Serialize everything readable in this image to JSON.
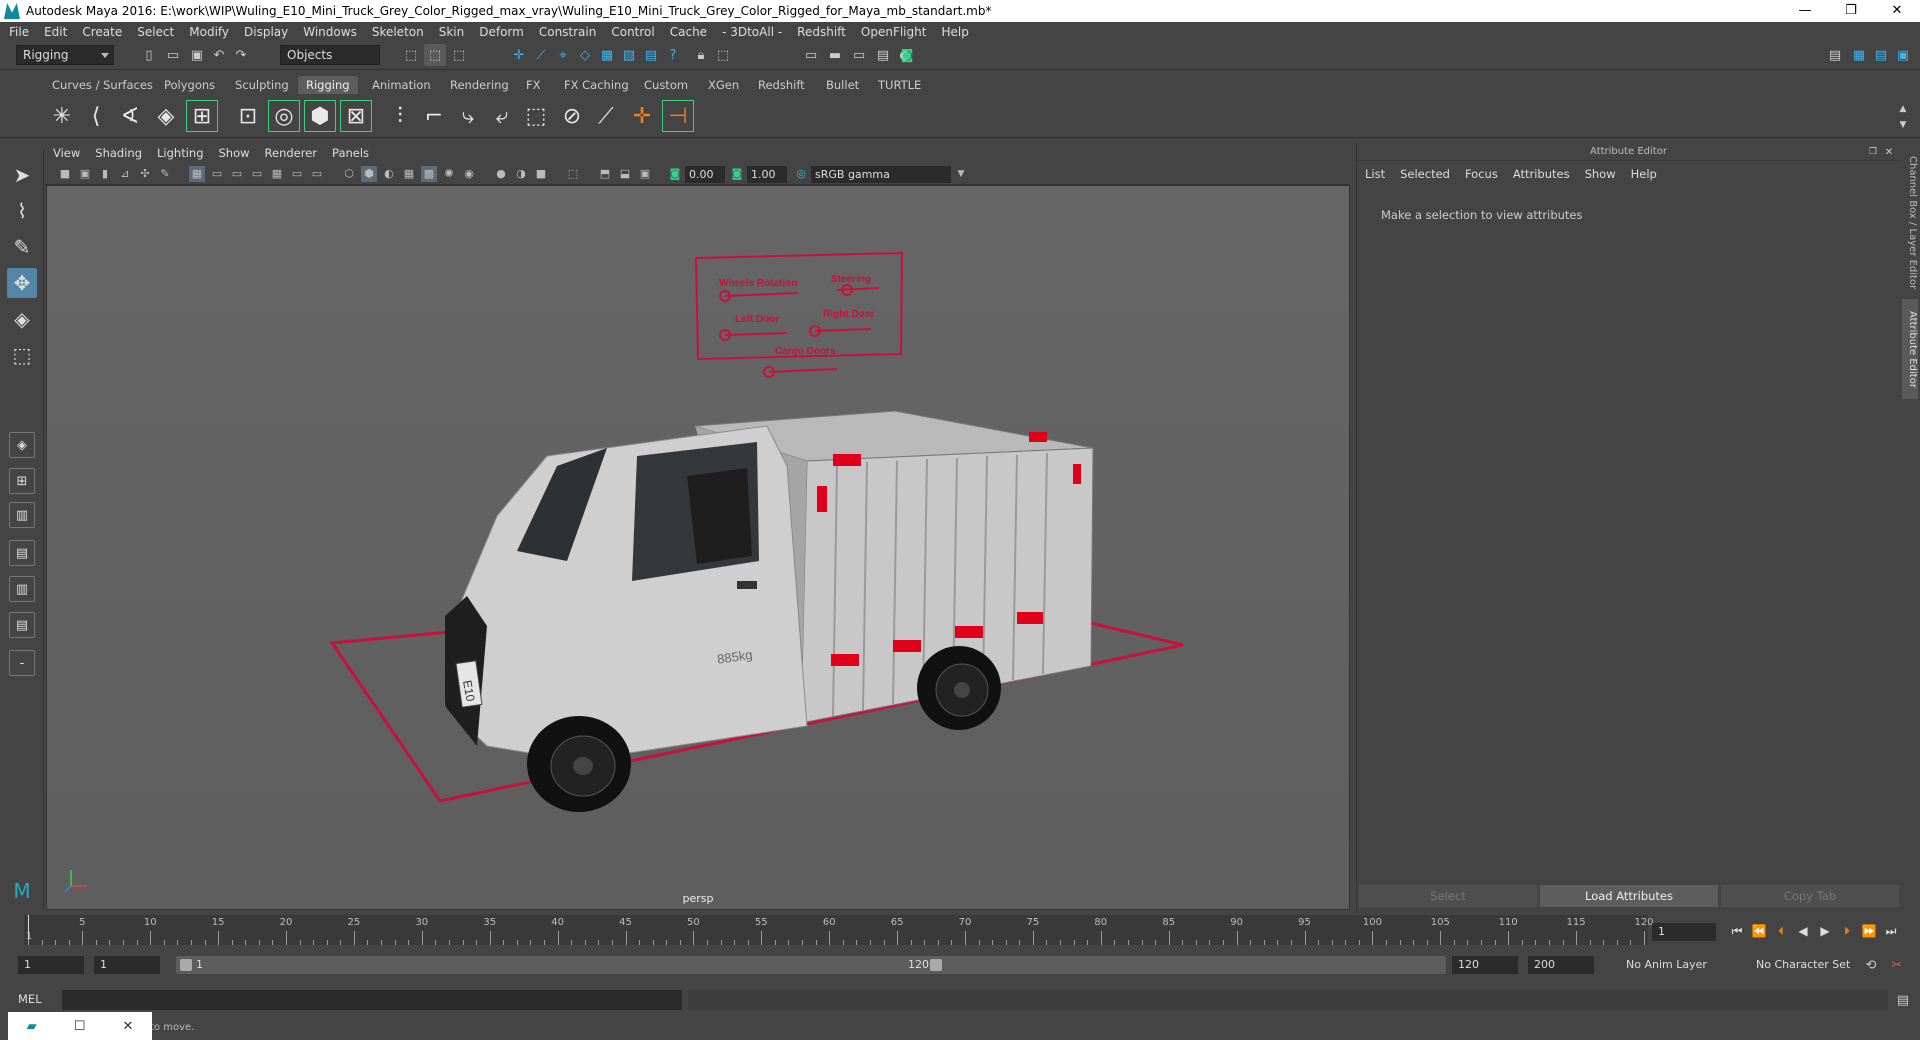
{
  "window": {
    "title": "Autodesk Maya 2016: E:\\work\\WIP\\Wuling_E10_Mini_Truck_Grey_Color_Rigged_max_vray\\Wuling_E10_Mini_Truck_Grey_Color_Rigged_for_Maya_mb_standart.mb*",
    "minimize": "—",
    "maximize": "❐",
    "close": "✕"
  },
  "menu": [
    "File",
    "Edit",
    "Create",
    "Select",
    "Modify",
    "Display",
    "Windows",
    "Skeleton",
    "Skin",
    "Deform",
    "Constrain",
    "Control",
    "Cache",
    "- 3DtoAll -",
    "Redshift",
    "OpenFlight",
    "Help"
  ],
  "statusline": {
    "mode": "Rigging",
    "selection_mode": "Objects"
  },
  "shelf_tabs": [
    "Curves / Surfaces",
    "Polygons",
    "Sculpting",
    "Rigging",
    "Animation",
    "Rendering",
    "FX",
    "FX Caching",
    "Custom",
    "XGen",
    "Redshift",
    "Bullet",
    "TURTLE"
  ],
  "active_shelf_tab": "Rigging",
  "viewport": {
    "menu": [
      "View",
      "Shading",
      "Lighting",
      "Show",
      "Renderer",
      "Panels"
    ],
    "exposure": "0.00",
    "gamma": "1.00",
    "color_space": "sRGB gamma",
    "camera_label": "persp",
    "truck_weight_label": "885kg",
    "truck_plate": "E10",
    "rig_panel": {
      "labels": [
        "Wheels Rotation",
        "Steering",
        "Left Door",
        "Right Door",
        "Cargo Doors"
      ]
    },
    "colors": {
      "rig": "#c8123c",
      "accent_active": "#5285a6"
    }
  },
  "attribute_editor": {
    "title": "Attribute Editor",
    "menu": [
      "List",
      "Selected",
      "Focus",
      "Attributes",
      "Show",
      "Help"
    ],
    "message": "Make a selection to view attributes",
    "buttons": {
      "select": "Select",
      "load": "Load Attributes",
      "copy": "Copy Tab"
    },
    "side_tabs": [
      "Channel Box / Layer Editor",
      "Attribute Editor"
    ]
  },
  "timeslider": {
    "ticks": [
      "5",
      "10",
      "15",
      "20",
      "25",
      "30",
      "35",
      "40",
      "45",
      "50",
      "55",
      "60",
      "65",
      "70",
      "75",
      "80",
      "85",
      "90",
      "95",
      "100",
      "105",
      "110",
      "115",
      "120"
    ],
    "start_label": "1",
    "current_frame": "1"
  },
  "range": {
    "start": "1",
    "playback_start": "1",
    "range_start_label": "1",
    "range_end_label": "120",
    "playback_end": "120",
    "end": "200",
    "anim_layer": "No Anim Layer",
    "character_set": "No Character Set"
  },
  "command": {
    "language": "MEL"
  },
  "help_line": "to move."
}
